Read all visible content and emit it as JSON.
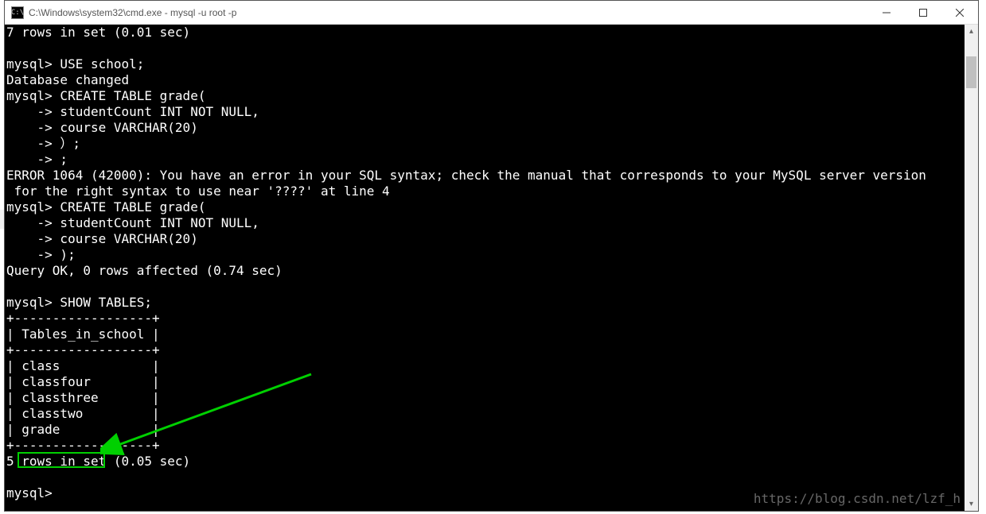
{
  "window": {
    "title": "C:\\Windows\\system32\\cmd.exe - mysql  -u root -p",
    "icon_label": "C:\\"
  },
  "controls": {
    "minimize_glyph": "—",
    "maximize_glyph": "☐",
    "close_glyph": "✕"
  },
  "terminal": {
    "lines": [
      "7 rows in set (0.01 sec)",
      "",
      "mysql> USE school;",
      "Database changed",
      "mysql> CREATE TABLE grade(",
      "    -> studentCount INT NOT NULL,",
      "    -> course VARCHAR(20)",
      "    -> ）;",
      "    -> ;",
      "ERROR 1064 (42000): You have an error in your SQL syntax; check the manual that corresponds to your MySQL server version",
      " for the right syntax to use near '????' at line 4",
      "mysql> CREATE TABLE grade(",
      "    -> studentCount INT NOT NULL,",
      "    -> course VARCHAR(20)",
      "    -> );",
      "Query OK, 0 rows affected (0.74 sec)",
      "",
      "mysql> SHOW TABLES;",
      "+------------------+",
      "| Tables_in_school |",
      "+------------------+",
      "| class            |",
      "| classfour        |",
      "| classthree       |",
      "| classtwo         |",
      "| grade            |",
      "+------------------+",
      "5 rows in set (0.05 sec)",
      "",
      "mysql>"
    ]
  },
  "annotation": {
    "highlight_target": "grade",
    "arrow_color": "#00d000"
  },
  "watermark": "https://blog.csdn.net/lzf_h",
  "scrollbar": {
    "up_glyph": "▴",
    "down_glyph": "▾"
  }
}
